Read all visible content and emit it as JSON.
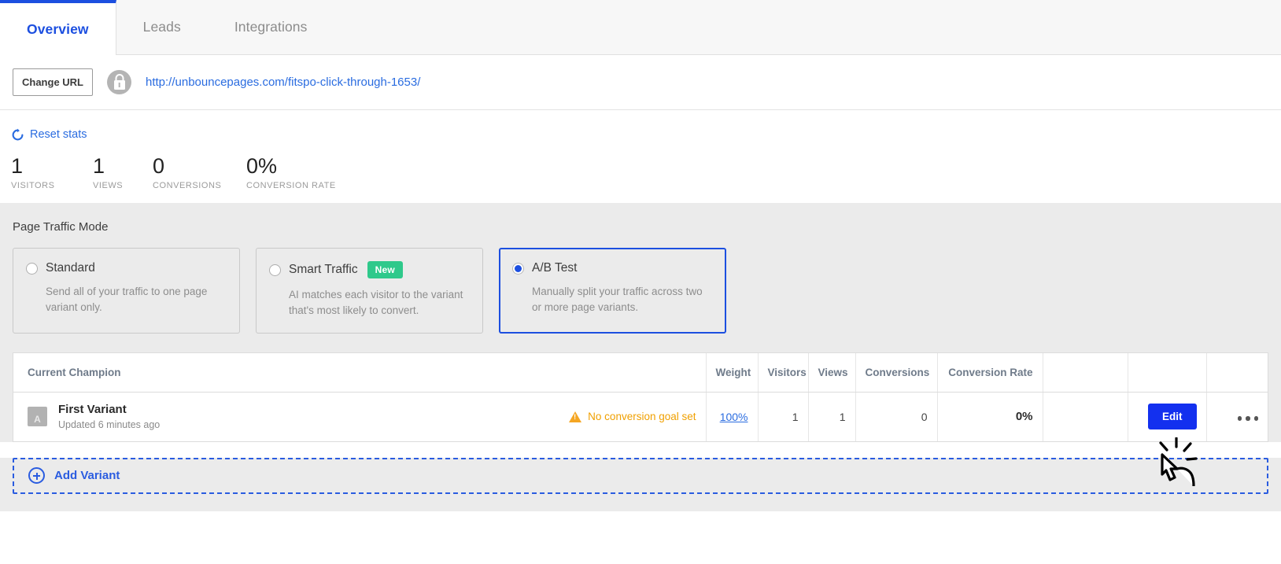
{
  "tabs": [
    {
      "label": "Overview",
      "active": true
    },
    {
      "label": "Leads",
      "active": false
    },
    {
      "label": "Integrations",
      "active": false
    }
  ],
  "url_bar": {
    "change_url_label": "Change URL",
    "lock_icon": "lock-icon",
    "url": "http://unbouncepages.com/fitspo-click-through-1653/"
  },
  "stats": {
    "reset_label": "Reset stats",
    "reset_icon": "refresh-icon",
    "items": [
      {
        "value": "1",
        "label": "VISITORS"
      },
      {
        "value": "1",
        "label": "VIEWS"
      },
      {
        "value": "0",
        "label": "CONVERSIONS"
      },
      {
        "value": "0%",
        "label": "CONVERSION RATE"
      }
    ]
  },
  "traffic_mode": {
    "title": "Page Traffic Mode",
    "options": [
      {
        "name": "Standard",
        "description": "Send all of your traffic to one page variant only.",
        "selected": false,
        "badge": ""
      },
      {
        "name": "Smart Traffic",
        "description": "AI matches each visitor to the variant that's most likely to convert.",
        "selected": false,
        "badge": "New"
      },
      {
        "name": "A/B Test",
        "description": "Manually split your traffic across two or more page variants.",
        "selected": true,
        "badge": ""
      }
    ]
  },
  "variants_table": {
    "headers": {
      "champion": "Current Champion",
      "weight": "Weight",
      "visitors": "Visitors",
      "views": "Views",
      "conversions": "Conversions",
      "conversion_rate": "Conversion Rate"
    },
    "rows": [
      {
        "thumb_letter": "A",
        "name": "First Variant",
        "updated": "Updated 6 minutes ago",
        "warning": "No conversion goal set",
        "weight": "100%",
        "visitors": "1",
        "views": "1",
        "conversions": "0",
        "conversion_rate": "0%",
        "edit_label": "Edit",
        "menu_icon": "ellipsis-icon"
      }
    ]
  },
  "add_variant": {
    "label": "Add Variant",
    "icon": "plus-circle-icon"
  },
  "colors": {
    "accent_blue": "#1c4fe0",
    "edit_blue": "#1330ef",
    "link_blue": "#2a6ce0",
    "warning_orange": "#f5a623",
    "badge_green": "#2fc98b",
    "panel_gray": "#ebebeb"
  }
}
